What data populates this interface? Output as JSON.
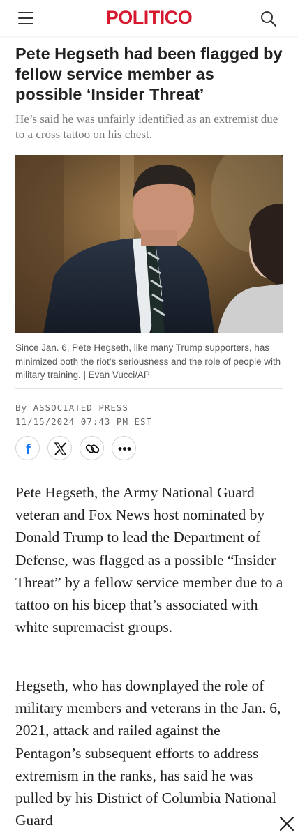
{
  "header": {
    "brand": "POLITICO",
    "brand_color": "#d7192f",
    "menu_icon": "hamburger-menu-icon",
    "search_icon": "search-icon"
  },
  "article": {
    "headline": "Pete Hegseth had been flagged by fellow service member as possible ‘Insider Threat’",
    "dek": "He’s said he was unfairly identified as an extremist due to a cross tattoo on his chest.",
    "photo_caption": "Since Jan. 6, Pete Hegseth, like many Trump supporters, has minimized both the riot’s seriousness and the role of people with military training. | Evan Vucci/AP",
    "byline": "By ASSOCIATED PRESS",
    "timestamp": "11/15/2024 07:43 PM EST",
    "paragraphs": [
      "Pete Hegseth, the Army National Guard veteran and Fox News host nominated by Donald Trump to lead the Department of Defense, was flagged as a possible “Insider Threat” by a fellow service member due to a tattoo on his bicep that’s associated with white supremacist groups.",
      "Hegseth, who has downplayed the role of military members and veterans in the Jan. 6, 2021, attack and railed against the Pentagon’s subsequent efforts to address extremism in the ranks, has said he was pulled by his District of Columbia National Guard"
    ]
  },
  "share_buttons": [
    {
      "name": "facebook",
      "icon": "facebook-icon",
      "color": "#1877f2"
    },
    {
      "name": "x",
      "icon": "x-icon",
      "color": "#111111"
    },
    {
      "name": "copy-link",
      "icon": "link-icon",
      "color": "#111111"
    },
    {
      "name": "more",
      "icon": "more-icon",
      "color": "#111111"
    }
  ],
  "overlay": {
    "close_icon": "close-icon"
  }
}
